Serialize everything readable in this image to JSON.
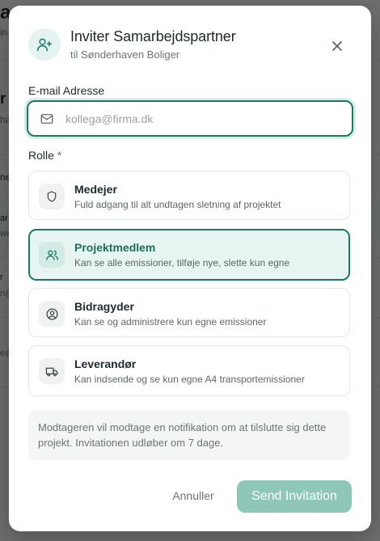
{
  "background": {
    "fragments": [
      "a",
      "in",
      "r",
      "ha",
      "ne",
      "ar",
      "we",
      "r",
      "n@",
      "e@"
    ]
  },
  "modal": {
    "title": "Inviter Samarbejdspartner",
    "subtitle": "til Sønderhaven Boliger",
    "header_icon": "user-plus-icon",
    "close_icon": "close-icon",
    "email": {
      "label": "E-mail Adresse",
      "placeholder": "kollega@firma.dk",
      "value": "",
      "icon": "mail-icon"
    },
    "role": {
      "label": "Rolle",
      "required_mark": "*",
      "options": [
        {
          "title": "Medejer",
          "description": "Fuld adgang til alt undtagen sletning af projektet",
          "icon": "shield-icon",
          "selected": false
        },
        {
          "title": "Projektmedlem",
          "description": "Kan se alle emissioner, tilføje nye, slette kun egne",
          "icon": "users-icon",
          "selected": true
        },
        {
          "title": "Bidragyder",
          "description": "Kan se og administrere kun egne emissioner",
          "icon": "user-circle-icon",
          "selected": false
        },
        {
          "title": "Leverandør",
          "description": "Kan indsende og se kun egne A4 transportemissioner",
          "icon": "truck-icon",
          "selected": false
        }
      ]
    },
    "note": "Modtageren vil modtage en notifikation om at tilslutte sig dette projekt. Invitationen udløber om 7 dage.",
    "cancel_label": "Annuller",
    "send_label": "Send Invitation"
  },
  "colors": {
    "accent": "#1b7a66",
    "accent_light": "#e7f4f1",
    "send_button": "#8ec6b8",
    "required": "#d9443a"
  }
}
